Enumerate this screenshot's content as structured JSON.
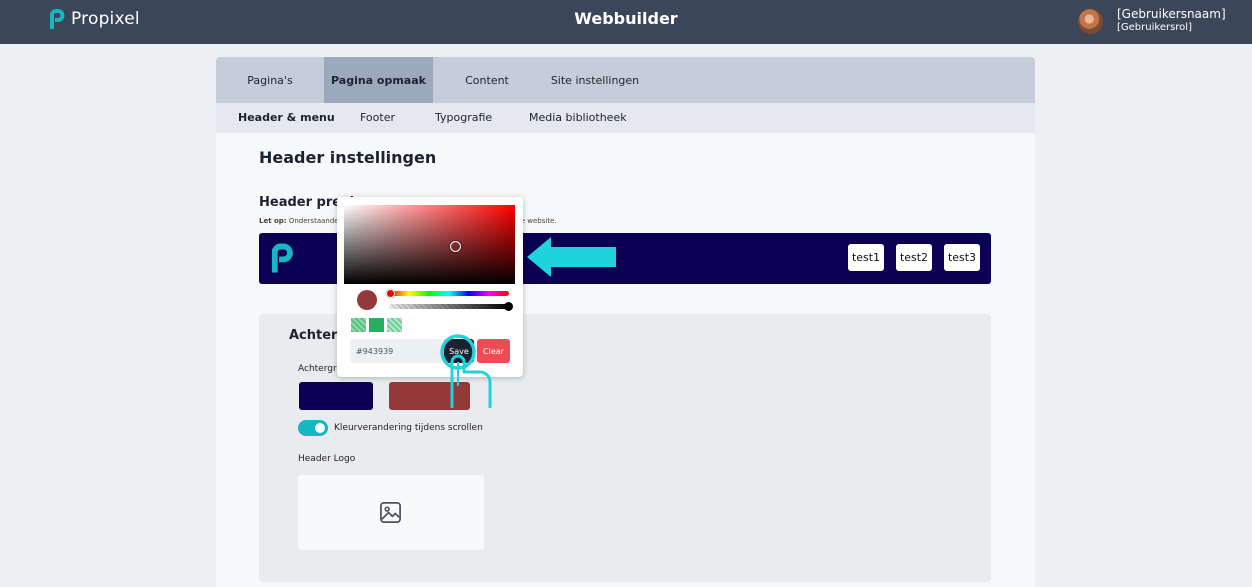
{
  "brand": {
    "name": "Propixel",
    "accent": "#14b7c4"
  },
  "app_title": "Webbuilder",
  "user": {
    "name": "[Gebruikersnaam]",
    "role": "[Gebruikersrol]"
  },
  "tabs": [
    {
      "label": "Pagina's",
      "active": false
    },
    {
      "label": "Pagina opmaak",
      "active": true
    },
    {
      "label": "Content",
      "active": false
    },
    {
      "label": "Site instellingen",
      "active": false
    }
  ],
  "subtabs": [
    {
      "label": "Header & menu",
      "active": true
    },
    {
      "label": "Footer",
      "active": false
    },
    {
      "label": "Typografie",
      "active": false
    },
    {
      "label": "Media bibliotheek",
      "active": false
    }
  ],
  "page_title": "Header instellingen",
  "header_preview": {
    "title": "Header previ",
    "note_prefix": "Let op:",
    "note_text": "Onderstaande",
    "note_tail": "re website.",
    "background": "#0b0053",
    "menu_buttons": [
      "test1",
      "test2",
      "test3"
    ]
  },
  "background_section": {
    "title": "Achterg",
    "label": "Achtergrond",
    "swatches": [
      "#0b0053",
      "#943939"
    ],
    "scroll_toggle": {
      "label": "Kleurverandering tijdens scrollen",
      "on": true
    },
    "logo_label": "Header Logo",
    "logo_icon": "image-icon"
  },
  "color_picker": {
    "hex_value": "#943939",
    "selected_color": "#943939",
    "save_label": "Save",
    "clear_label": "Clear",
    "clear_color": "#ee4b54",
    "presets": [
      "#52c27a",
      "#27ae60",
      "#6fcf97"
    ]
  }
}
